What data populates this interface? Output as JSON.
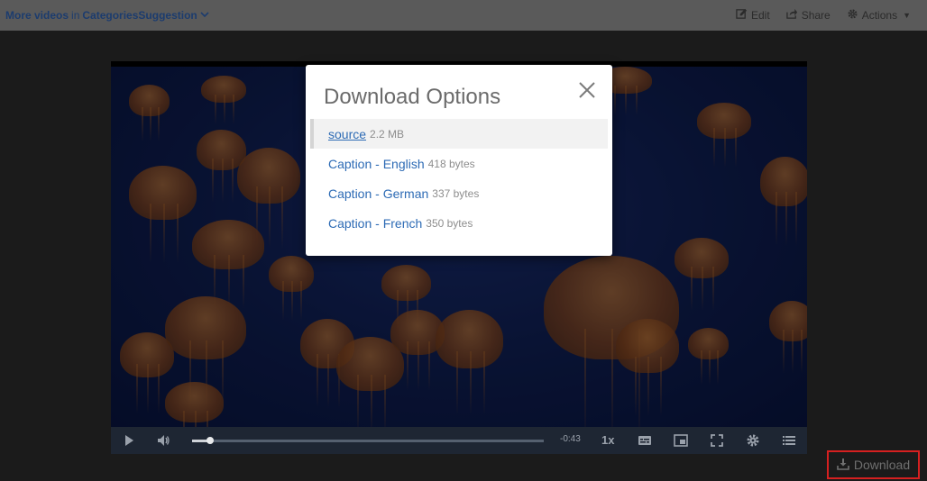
{
  "topbar": {
    "more_videos": "More videos",
    "in": "in",
    "categories": "Categories",
    "suggestion": "Suggestion",
    "actions": [
      {
        "label": "Edit",
        "icon": "edit-icon"
      },
      {
        "label": "Share",
        "icon": "share-icon"
      },
      {
        "label": "Actions",
        "icon": "gear-icon"
      }
    ]
  },
  "player": {
    "progress": 0.05,
    "time_remaining": "-0:43",
    "playback_rate": "1x"
  },
  "modal": {
    "title": "Download Options",
    "options": [
      {
        "label": "source",
        "size": "2.2 MB",
        "selected": true
      },
      {
        "label": "Caption - English",
        "size": "418 bytes",
        "selected": false
      },
      {
        "label": "Caption - German",
        "size": "337 bytes",
        "selected": false
      },
      {
        "label": "Caption - French",
        "size": "350 bytes",
        "selected": false
      }
    ]
  },
  "download_button": {
    "label": "Download"
  },
  "colors": {
    "accent_link": "#2d6bb5",
    "highlight_border": "#d62020",
    "topbar_bg": "#5a5a5a"
  }
}
